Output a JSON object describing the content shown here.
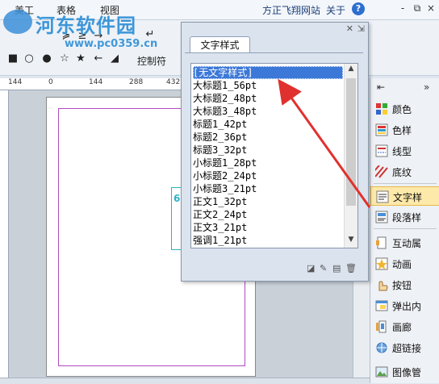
{
  "menubar": {
    "items": [
      "美工",
      "表格",
      "视图"
    ],
    "right_links": [
      "方正飞翔网站",
      "关于"
    ],
    "help_icon": "help-icon",
    "window_controls": [
      "-",
      "⧉",
      "×"
    ]
  },
  "ribbon": {
    "control_label": "控制符"
  },
  "watermark": {
    "title": "河东软件园",
    "url": "www.pc0359.cn"
  },
  "ruler": {
    "labels": [
      "144",
      "0",
      "144",
      "288",
      "432"
    ]
  },
  "canvas": {
    "textbox_text": "6("
  },
  "panel": {
    "tab_label": "文字样式",
    "styles": [
      "[无文字样式]",
      "大标题1_56pt",
      "大标题2_48pt",
      "大标题3_48pt",
      "标题1_42pt",
      "标题2_36pt",
      "标题3_32pt",
      "小标题1_28pt",
      "小标题2_24pt",
      "小标题3_21pt",
      "正文1_32pt",
      "正文2_24pt",
      "正文3_21pt",
      "强调1_21pt"
    ],
    "selected_index": 0
  },
  "sidepanel": {
    "items": [
      {
        "label": "颜色",
        "icon": "color-grid-icon"
      },
      {
        "label": "色样",
        "icon": "swatch-icon"
      },
      {
        "label": "线型",
        "icon": "line-style-icon"
      },
      {
        "label": "底纹",
        "icon": "shading-icon"
      },
      {
        "label": "文字样",
        "icon": "text-style-icon"
      },
      {
        "label": "段落样",
        "icon": "paragraph-style-icon"
      },
      {
        "label": "互动属",
        "icon": "interaction-icon"
      },
      {
        "label": "动画",
        "icon": "animation-icon"
      },
      {
        "label": "按钮",
        "icon": "button-icon"
      },
      {
        "label": "弹出内",
        "icon": "popup-icon"
      },
      {
        "label": "画廊",
        "icon": "gallery-icon"
      },
      {
        "label": "超链接",
        "icon": "hyperlink-icon"
      },
      {
        "label": "图像管",
        "icon": "image-manager-icon"
      }
    ],
    "active_index": 4
  },
  "colors": {
    "selection": "#3b78d8",
    "arrow": "#e0312e",
    "active_side": "#fde9a9"
  }
}
